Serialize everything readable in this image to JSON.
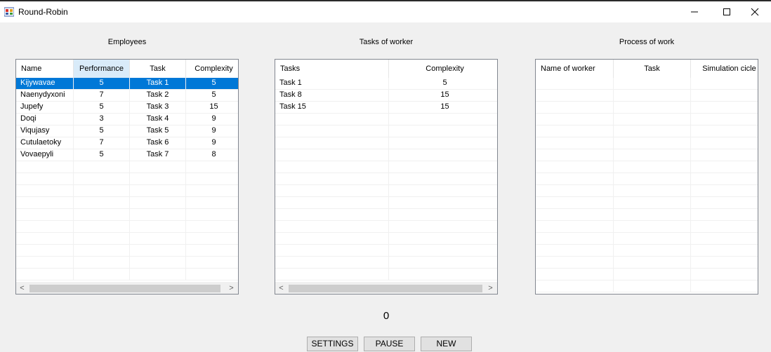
{
  "window": {
    "title": "Round-Robin"
  },
  "sections": {
    "employees": "Employees",
    "tasks": "Tasks of worker",
    "process": "Process of work"
  },
  "employees_grid": {
    "columns": [
      "Name",
      "Performance",
      "Task",
      "Complexity"
    ],
    "rows": [
      [
        "Kijywavae",
        "5",
        "Task 1",
        "5"
      ],
      [
        "Naenydyxoni",
        "7",
        "Task 2",
        "5"
      ],
      [
        "Jupefy",
        "5",
        "Task 3",
        "15"
      ],
      [
        "Doqi",
        "3",
        "Task 4",
        "9"
      ],
      [
        "Viqujasy",
        "5",
        "Task 5",
        "9"
      ],
      [
        "Cutulaetoky",
        "7",
        "Task 6",
        "9"
      ],
      [
        "Vovaepyli",
        "5",
        "Task 7",
        "8"
      ]
    ]
  },
  "tasks_grid": {
    "columns": [
      "Tasks",
      "Complexity"
    ],
    "rows": [
      [
        "Task 1",
        "5"
      ],
      [
        "Task 8",
        "15"
      ],
      [
        "Task 15",
        "15"
      ]
    ]
  },
  "process_grid": {
    "columns": [
      "Name of worker",
      "Task",
      "Simulation cicle"
    ],
    "rows": []
  },
  "counter": "0",
  "buttons": {
    "settings": "SETTINGS",
    "pause": "PAUSE",
    "new": "NEW"
  },
  "colors": {
    "selection": "#0078d7",
    "header_highlight": "#d9ebf9"
  }
}
